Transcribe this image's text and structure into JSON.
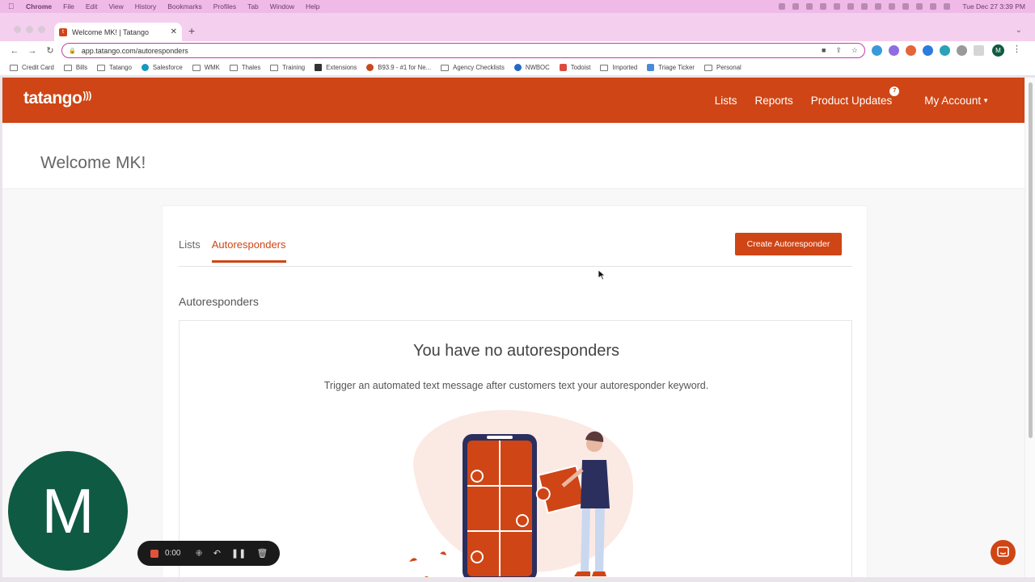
{
  "menubar": {
    "app": "Chrome",
    "items": [
      "File",
      "Edit",
      "View",
      "History",
      "Bookmarks",
      "Profiles",
      "Tab",
      "Window",
      "Help"
    ],
    "clock": "Tue Dec 27  3:39 PM"
  },
  "browser": {
    "tab_title": "Welcome MK! | Tatango",
    "url": "app.tatango.com/autoresponders",
    "profile_initial": "M",
    "bookmarks": [
      "Credit Card",
      "Bills",
      "Tatango",
      "Salesforce",
      "WMK",
      "Thales",
      "Training",
      "Extensions",
      "B93.9 - #1 for Ne...",
      "Agency Checklists",
      "NWBOC",
      "Todoist",
      "Imported",
      "Triage Ticker",
      "Personal"
    ]
  },
  "app": {
    "logo": "tatango",
    "nav": {
      "lists": "Lists",
      "reports": "Reports",
      "product_updates": "Product Updates",
      "updates_badge": "7",
      "my_account": "My Account"
    },
    "welcome": "Welcome MK!",
    "tabs": [
      "Lists",
      "Autoresponders"
    ],
    "active_tab": "Autoresponders",
    "create_button": "Create Autoresponder",
    "section_title": "Autoresponders",
    "empty": {
      "title": "You have no autoresponders",
      "subtitle": "Trigger an automated text message after customers text your autoresponder keyword."
    }
  },
  "overlay": {
    "camera_initial": "M",
    "recording_time": "0:00"
  },
  "colors": {
    "brand": "#cf4515",
    "omnibox_border": "#c53aa4",
    "camera_bg": "#0f5a42"
  }
}
